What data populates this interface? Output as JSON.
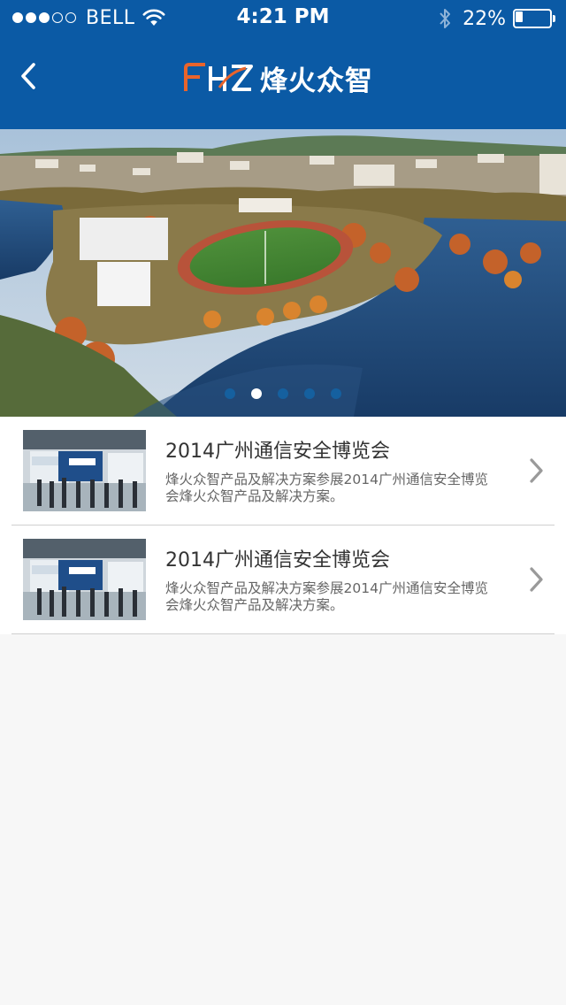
{
  "status_bar": {
    "signal_filled": 3,
    "signal_total": 5,
    "carrier": "BELL",
    "time": "4:21 PM",
    "battery_percent_label": "22%",
    "battery_level": 0.22,
    "icons": [
      "wifi-icon",
      "bluetooth-icon",
      "battery-icon"
    ]
  },
  "nav": {
    "back_icon": "chevron-left-icon",
    "logo_mark": "FHZ",
    "logo_name": "烽火众智"
  },
  "banner": {
    "page_count": 5,
    "active_page": 1
  },
  "list": {
    "items": [
      {
        "title": "2014广州通信安全博览会",
        "description": "烽火众智产品及解决方案参展2014广州通信安全博览会烽火众智产品及解决方案。"
      },
      {
        "title": "2014广州通信安全博览会",
        "description": "烽火众智产品及解决方案参展2014广州通信安全博览会烽火众智产品及解决方案。"
      }
    ]
  },
  "colors": {
    "header_bg": "#0b5aa5",
    "logo_accent": "#e8642c",
    "page_bg": "#f7f7f7",
    "pager_inactive": "#15609f",
    "pager_active": "#ffffff"
  }
}
